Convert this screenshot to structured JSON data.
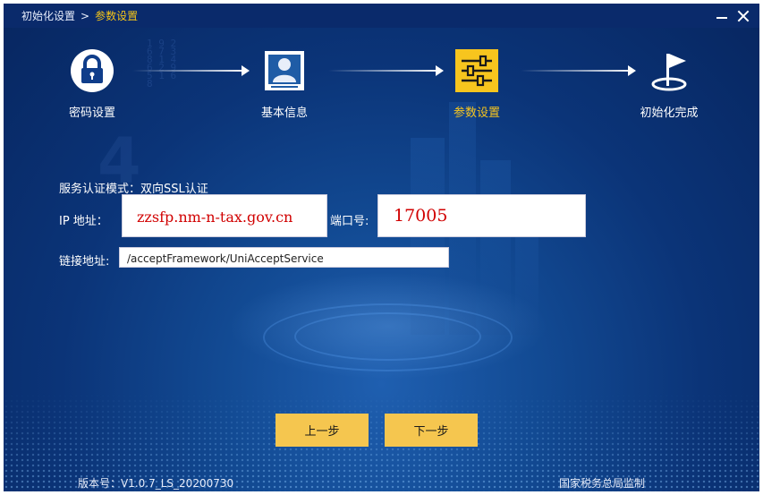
{
  "titlebar": {
    "crumb_root": "初始化设置",
    "crumb_sep": ">",
    "crumb_current": "参数设置"
  },
  "steps": [
    {
      "label": "密码设置",
      "icon": "lock-icon"
    },
    {
      "label": "基本信息",
      "icon": "user-id-card-icon"
    },
    {
      "label": "参数设置",
      "icon": "sliders-icon",
      "active": true
    },
    {
      "label": "初始化完成",
      "icon": "flag-icon"
    }
  ],
  "form": {
    "auth_mode_label": "服务认证模式：",
    "auth_mode_value": "双向SSL认证",
    "ip_label": "IP 地址：",
    "ip_value": "zzsfp.nm-n-tax.gov.cn",
    "port_label": "端口号:",
    "port_value": "17005",
    "link_label": "链接地址:",
    "link_value": "/acceptFramework/UniAcceptService"
  },
  "buttons": {
    "prev": "上一步",
    "next": "下一步"
  },
  "footer": {
    "version": "版本号：V1.0.7_LS_20200730",
    "supervisor": "国家税务总局监制"
  },
  "colors": {
    "accent": "#f7c51e",
    "button": "#f5c64f",
    "background": "#0b3478"
  }
}
